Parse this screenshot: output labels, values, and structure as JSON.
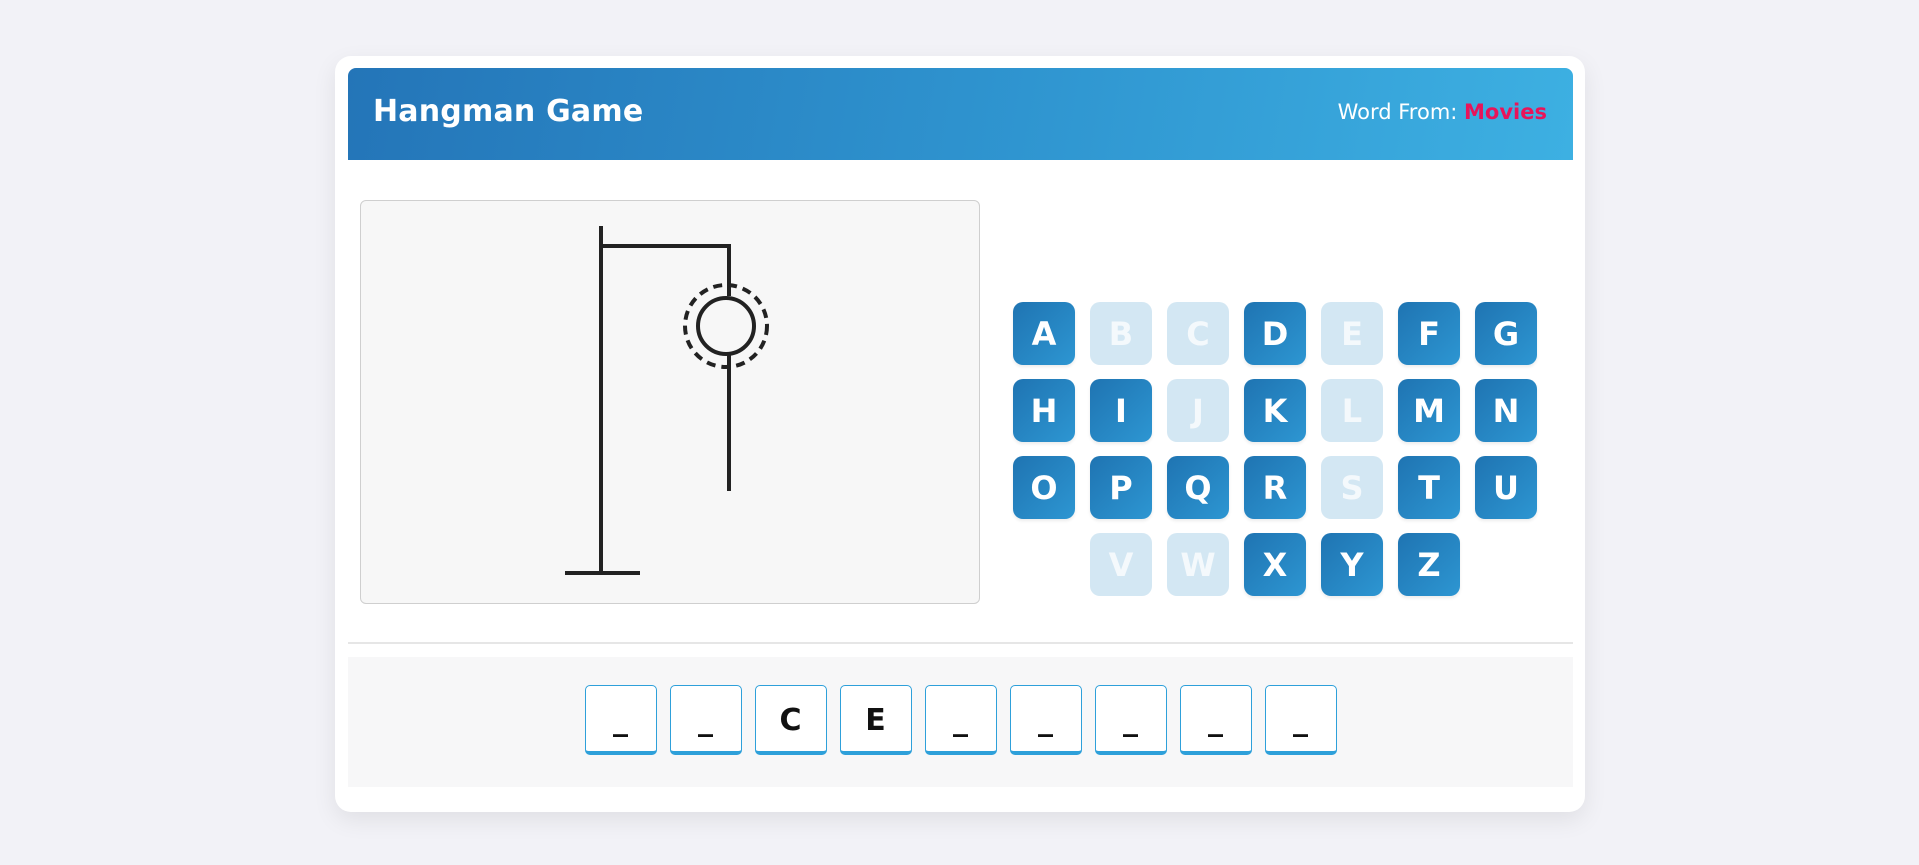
{
  "header": {
    "title": "Hangman Game",
    "word_from_label": "Word From: ",
    "category": "Movies"
  },
  "colors": {
    "accent": "#2f95d0",
    "category": "#e8145a",
    "used_key": "#d3e7f3"
  },
  "keyboard": {
    "keys": [
      {
        "letter": "A",
        "used": false
      },
      {
        "letter": "B",
        "used": true
      },
      {
        "letter": "C",
        "used": true
      },
      {
        "letter": "D",
        "used": false
      },
      {
        "letter": "E",
        "used": true
      },
      {
        "letter": "F",
        "used": false
      },
      {
        "letter": "G",
        "used": false
      },
      {
        "letter": "H",
        "used": false
      },
      {
        "letter": "I",
        "used": false
      },
      {
        "letter": "J",
        "used": true
      },
      {
        "letter": "K",
        "used": false
      },
      {
        "letter": "L",
        "used": true
      },
      {
        "letter": "M",
        "used": false
      },
      {
        "letter": "N",
        "used": false
      },
      {
        "letter": "O",
        "used": false
      },
      {
        "letter": "P",
        "used": false
      },
      {
        "letter": "Q",
        "used": false
      },
      {
        "letter": "R",
        "used": false
      },
      {
        "letter": "S",
        "used": true
      },
      {
        "letter": "T",
        "used": false
      },
      {
        "letter": "U",
        "used": false
      },
      {
        "letter": "V",
        "used": true
      },
      {
        "letter": "W",
        "used": true
      },
      {
        "letter": "X",
        "used": false
      },
      {
        "letter": "Y",
        "used": false
      },
      {
        "letter": "Z",
        "used": false
      }
    ]
  },
  "word": {
    "slots": [
      "_",
      "_",
      "C",
      "E",
      "_",
      "_",
      "_",
      "_",
      "_"
    ]
  },
  "gallows": {
    "parts_visible": [
      "base",
      "pole",
      "beam",
      "rope",
      "head",
      "body"
    ]
  }
}
